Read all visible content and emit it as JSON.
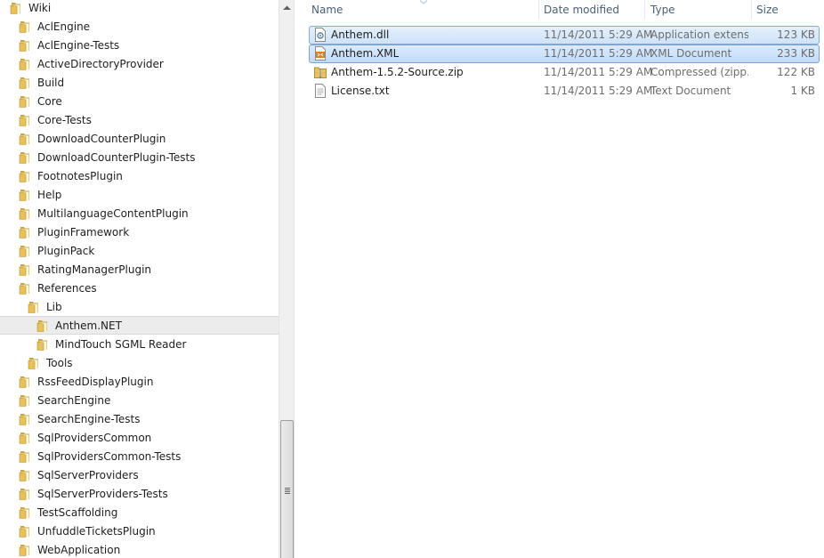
{
  "tree": {
    "items": [
      {
        "label": "Wiki",
        "level": 0
      },
      {
        "label": "AclEngine",
        "level": 1
      },
      {
        "label": "AclEngine-Tests",
        "level": 1
      },
      {
        "label": "ActiveDirectoryProvider",
        "level": 1
      },
      {
        "label": "Build",
        "level": 1
      },
      {
        "label": "Core",
        "level": 1
      },
      {
        "label": "Core-Tests",
        "level": 1
      },
      {
        "label": "DownloadCounterPlugin",
        "level": 1
      },
      {
        "label": "DownloadCounterPlugin-Tests",
        "level": 1
      },
      {
        "label": "FootnotesPlugin",
        "level": 1
      },
      {
        "label": "Help",
        "level": 1
      },
      {
        "label": "MultilanguageContentPlugin",
        "level": 1
      },
      {
        "label": "PluginFramework",
        "level": 1
      },
      {
        "label": "PluginPack",
        "level": 1
      },
      {
        "label": "RatingManagerPlugin",
        "level": 1
      },
      {
        "label": "References",
        "level": 1
      },
      {
        "label": "Lib",
        "level": 2
      },
      {
        "label": "Anthem.NET",
        "level": 3,
        "selected": true
      },
      {
        "label": "MindTouch SGML Reader",
        "level": 3
      },
      {
        "label": "Tools",
        "level": 2
      },
      {
        "label": "RssFeedDisplayPlugin",
        "level": 1
      },
      {
        "label": "SearchEngine",
        "level": 1
      },
      {
        "label": "SearchEngine-Tests",
        "level": 1
      },
      {
        "label": "SqlProvidersCommon",
        "level": 1
      },
      {
        "label": "SqlProvidersCommon-Tests",
        "level": 1
      },
      {
        "label": "SqlServerProviders",
        "level": 1
      },
      {
        "label": "SqlServerProviders-Tests",
        "level": 1
      },
      {
        "label": "TestScaffolding",
        "level": 1
      },
      {
        "label": "UnfuddleTicketsPlugin",
        "level": 1
      },
      {
        "label": "WebApplication",
        "level": 1
      }
    ]
  },
  "columns": {
    "name": "Name",
    "date": "Date modified",
    "type": "Type",
    "size": "Size"
  },
  "files": [
    {
      "name": "Anthem.dll",
      "date": "11/14/2011 5:29 AM",
      "type": "Application extens...",
      "size": "123 KB",
      "icon": "dll-icon",
      "state": "selected"
    },
    {
      "name": "Anthem.XML",
      "date": "11/14/2011 5:29 AM",
      "type": "XML Document",
      "size": "233 KB",
      "icon": "xml-icon",
      "state": "selected"
    },
    {
      "name": "Anthem-1.5.2-Source.zip",
      "date": "11/14/2011 5:29 AM",
      "type": "Compressed (zipp...",
      "size": "122 KB",
      "icon": "zip-folder-icon",
      "state": "normal"
    },
    {
      "name": "License.txt",
      "date": "11/14/2011 5:29 AM",
      "type": "Text Document",
      "size": "1 KB",
      "icon": "text-file-icon",
      "state": "normal"
    }
  ],
  "colors": {
    "folder": "#e8c15a",
    "selection_border": "#7da2ce",
    "header_text": "#4c607a"
  }
}
